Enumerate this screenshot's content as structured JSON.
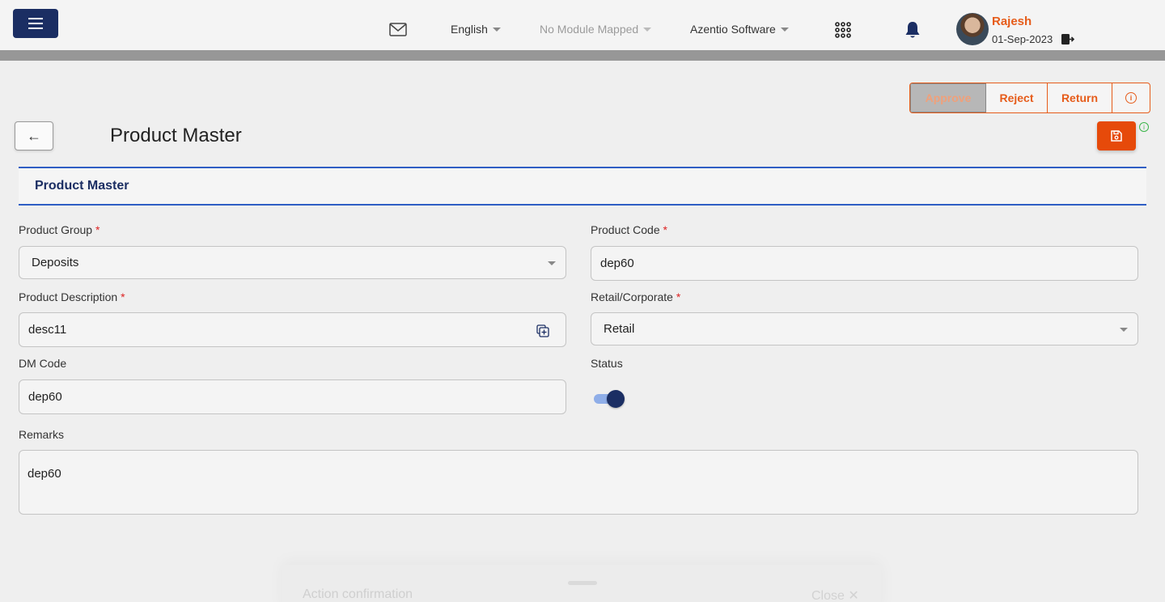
{
  "header": {
    "language": "English",
    "module": "No Module Mapped",
    "company": "Azentio Software",
    "user_name": "Rajesh",
    "date": "01-Sep-2023",
    "icons": [
      "menu-icon",
      "mail-icon",
      "apps-grid-icon",
      "bell-icon",
      "logout-icon"
    ]
  },
  "actions": {
    "approve": "Approve",
    "reject": "Reject",
    "return": "Return"
  },
  "page": {
    "title": "Product Master",
    "section_title": "Product Master"
  },
  "form": {
    "product_group": {
      "label": "Product Group",
      "value": "Deposits"
    },
    "product_code": {
      "label": "Product Code",
      "value": "dep60"
    },
    "product_description": {
      "label": "Product Description",
      "value": "desc11"
    },
    "retail_corporate": {
      "label": "Retail/Corporate",
      "value": "Retail"
    },
    "dm_code": {
      "label": "DM Code",
      "value": "dep60"
    },
    "status": {
      "label": "Status",
      "enabled": true
    },
    "remarks": {
      "label": "Remarks",
      "value": "dep60"
    },
    "required_marker": "*"
  },
  "dialog": {
    "title": "Action confirmation",
    "close": "Close ✕"
  },
  "colors": {
    "brand_navy": "#1b2e63",
    "accent_orange": "#e65c1a",
    "section_blue": "#2f5ec4"
  }
}
